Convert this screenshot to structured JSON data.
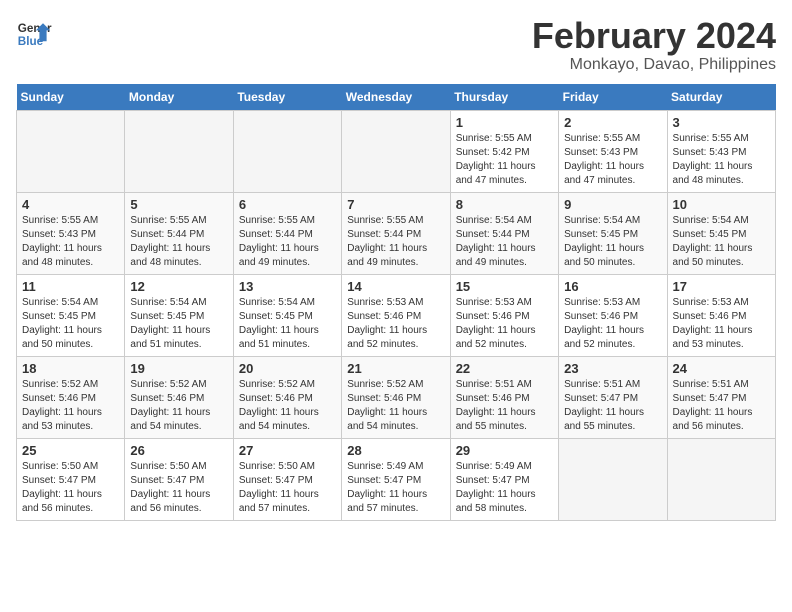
{
  "logo": {
    "line1": "General",
    "line2": "Blue"
  },
  "title": "February 2024",
  "subtitle": "Monkayo, Davao, Philippines",
  "weekdays": [
    "Sunday",
    "Monday",
    "Tuesday",
    "Wednesday",
    "Thursday",
    "Friday",
    "Saturday"
  ],
  "weeks": [
    [
      {
        "day": "",
        "info": ""
      },
      {
        "day": "",
        "info": ""
      },
      {
        "day": "",
        "info": ""
      },
      {
        "day": "",
        "info": ""
      },
      {
        "day": "1",
        "info": "Sunrise: 5:55 AM\nSunset: 5:42 PM\nDaylight: 11 hours\nand 47 minutes."
      },
      {
        "day": "2",
        "info": "Sunrise: 5:55 AM\nSunset: 5:43 PM\nDaylight: 11 hours\nand 47 minutes."
      },
      {
        "day": "3",
        "info": "Sunrise: 5:55 AM\nSunset: 5:43 PM\nDaylight: 11 hours\nand 48 minutes."
      }
    ],
    [
      {
        "day": "4",
        "info": "Sunrise: 5:55 AM\nSunset: 5:43 PM\nDaylight: 11 hours\nand 48 minutes."
      },
      {
        "day": "5",
        "info": "Sunrise: 5:55 AM\nSunset: 5:44 PM\nDaylight: 11 hours\nand 48 minutes."
      },
      {
        "day": "6",
        "info": "Sunrise: 5:55 AM\nSunset: 5:44 PM\nDaylight: 11 hours\nand 49 minutes."
      },
      {
        "day": "7",
        "info": "Sunrise: 5:55 AM\nSunset: 5:44 PM\nDaylight: 11 hours\nand 49 minutes."
      },
      {
        "day": "8",
        "info": "Sunrise: 5:54 AM\nSunset: 5:44 PM\nDaylight: 11 hours\nand 49 minutes."
      },
      {
        "day": "9",
        "info": "Sunrise: 5:54 AM\nSunset: 5:45 PM\nDaylight: 11 hours\nand 50 minutes."
      },
      {
        "day": "10",
        "info": "Sunrise: 5:54 AM\nSunset: 5:45 PM\nDaylight: 11 hours\nand 50 minutes."
      }
    ],
    [
      {
        "day": "11",
        "info": "Sunrise: 5:54 AM\nSunset: 5:45 PM\nDaylight: 11 hours\nand 50 minutes."
      },
      {
        "day": "12",
        "info": "Sunrise: 5:54 AM\nSunset: 5:45 PM\nDaylight: 11 hours\nand 51 minutes."
      },
      {
        "day": "13",
        "info": "Sunrise: 5:54 AM\nSunset: 5:45 PM\nDaylight: 11 hours\nand 51 minutes."
      },
      {
        "day": "14",
        "info": "Sunrise: 5:53 AM\nSunset: 5:46 PM\nDaylight: 11 hours\nand 52 minutes."
      },
      {
        "day": "15",
        "info": "Sunrise: 5:53 AM\nSunset: 5:46 PM\nDaylight: 11 hours\nand 52 minutes."
      },
      {
        "day": "16",
        "info": "Sunrise: 5:53 AM\nSunset: 5:46 PM\nDaylight: 11 hours\nand 52 minutes."
      },
      {
        "day": "17",
        "info": "Sunrise: 5:53 AM\nSunset: 5:46 PM\nDaylight: 11 hours\nand 53 minutes."
      }
    ],
    [
      {
        "day": "18",
        "info": "Sunrise: 5:52 AM\nSunset: 5:46 PM\nDaylight: 11 hours\nand 53 minutes."
      },
      {
        "day": "19",
        "info": "Sunrise: 5:52 AM\nSunset: 5:46 PM\nDaylight: 11 hours\nand 54 minutes."
      },
      {
        "day": "20",
        "info": "Sunrise: 5:52 AM\nSunset: 5:46 PM\nDaylight: 11 hours\nand 54 minutes."
      },
      {
        "day": "21",
        "info": "Sunrise: 5:52 AM\nSunset: 5:46 PM\nDaylight: 11 hours\nand 54 minutes."
      },
      {
        "day": "22",
        "info": "Sunrise: 5:51 AM\nSunset: 5:46 PM\nDaylight: 11 hours\nand 55 minutes."
      },
      {
        "day": "23",
        "info": "Sunrise: 5:51 AM\nSunset: 5:47 PM\nDaylight: 11 hours\nand 55 minutes."
      },
      {
        "day": "24",
        "info": "Sunrise: 5:51 AM\nSunset: 5:47 PM\nDaylight: 11 hours\nand 56 minutes."
      }
    ],
    [
      {
        "day": "25",
        "info": "Sunrise: 5:50 AM\nSunset: 5:47 PM\nDaylight: 11 hours\nand 56 minutes."
      },
      {
        "day": "26",
        "info": "Sunrise: 5:50 AM\nSunset: 5:47 PM\nDaylight: 11 hours\nand 56 minutes."
      },
      {
        "day": "27",
        "info": "Sunrise: 5:50 AM\nSunset: 5:47 PM\nDaylight: 11 hours\nand 57 minutes."
      },
      {
        "day": "28",
        "info": "Sunrise: 5:49 AM\nSunset: 5:47 PM\nDaylight: 11 hours\nand 57 minutes."
      },
      {
        "day": "29",
        "info": "Sunrise: 5:49 AM\nSunset: 5:47 PM\nDaylight: 11 hours\nand 58 minutes."
      },
      {
        "day": "",
        "info": ""
      },
      {
        "day": "",
        "info": ""
      }
    ]
  ]
}
